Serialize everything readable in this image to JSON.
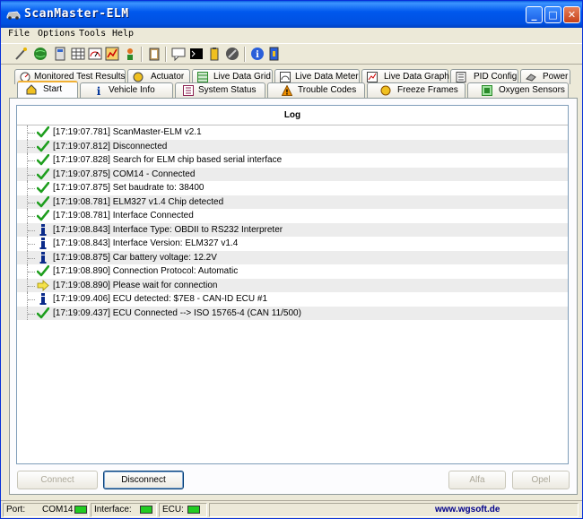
{
  "window": {
    "title": "ScanMaster-ELM",
    "controls": {
      "minimize": "_",
      "maximize": "□",
      "close": "✕"
    }
  },
  "menu": [
    "File",
    "Options",
    "Tools",
    "Help"
  ],
  "toolbar_icons": [
    "connect-icon",
    "globe-icon",
    "ecu-icon",
    "grid-icon",
    "meter-icon",
    "graph-icon",
    "person-icon",
    "clipboard-icon",
    "chat-icon",
    "terminal-icon",
    "battery-icon",
    "stop-icon",
    "info-icon",
    "exit-icon"
  ],
  "tabs_back": [
    {
      "label": "Monitored Test Results",
      "icon": "gauge-icon"
    },
    {
      "label": "Actuator",
      "icon": "actuator-icon"
    },
    {
      "label": "Live Data Grid",
      "icon": "grid-icon"
    },
    {
      "label": "Live Data Meter",
      "icon": "meter-icon"
    },
    {
      "label": "Live Data Graph",
      "icon": "graph-icon"
    },
    {
      "label": "PID Config",
      "icon": "config-icon"
    },
    {
      "label": "Power",
      "icon": "power-icon"
    }
  ],
  "tabs_front": [
    {
      "label": "Start",
      "icon": "home-icon",
      "active": true
    },
    {
      "label": "Vehicle Info",
      "icon": "info-icon"
    },
    {
      "label": "System Status",
      "icon": "status-icon"
    },
    {
      "label": "Trouble Codes",
      "icon": "warning-icon"
    },
    {
      "label": "Freeze Frames",
      "icon": "freeze-icon"
    },
    {
      "label": "Oxygen Sensors",
      "icon": "sensor-icon"
    }
  ],
  "log": {
    "header": "Log",
    "entries": [
      {
        "icon": "check",
        "text": "[17:19:07.781] ScanMaster-ELM v2.1"
      },
      {
        "icon": "check",
        "text": "[17:19:07.812] Disconnected"
      },
      {
        "icon": "check",
        "text": "[17:19:07.828] Search for ELM chip based serial interface"
      },
      {
        "icon": "check",
        "text": "[17:19:07.875] COM14 - Connected"
      },
      {
        "icon": "check",
        "text": "[17:19:07.875] Set baudrate to: 38400"
      },
      {
        "icon": "check",
        "text": "[17:19:08.781] ELM327 v1.4 Chip detected"
      },
      {
        "icon": "check",
        "text": "[17:19:08.781] Interface Connected"
      },
      {
        "icon": "info",
        "text": "[17:19:08.843] Interface Type: OBDII to RS232 Interpreter"
      },
      {
        "icon": "info",
        "text": "[17:19:08.843] Interface Version: ELM327 v1.4"
      },
      {
        "icon": "info",
        "text": "[17:19:08.875] Car battery voltage: 12.2V"
      },
      {
        "icon": "check",
        "text": "[17:19:08.890] Connection Protocol: Automatic"
      },
      {
        "icon": "arrow",
        "text": "[17:19:08.890] Please wait for connection"
      },
      {
        "icon": "info",
        "text": "[17:19:09.406] ECU detected: $7E8 - CAN-ID ECU #1"
      },
      {
        "icon": "check",
        "text": "[17:19:09.437] ECU Connected --> ISO 15765-4 (CAN 11/500)"
      }
    ]
  },
  "buttons": {
    "connect": "Connect",
    "disconnect": "Disconnect",
    "alfa": "Alfa",
    "opel": "Opel"
  },
  "status": {
    "port_label": "Port:",
    "port_value": "COM14",
    "interface_label": "Interface:",
    "ecu_label": "ECU:",
    "url": "www.wgsoft.de",
    "led_color": "#22cc22"
  }
}
